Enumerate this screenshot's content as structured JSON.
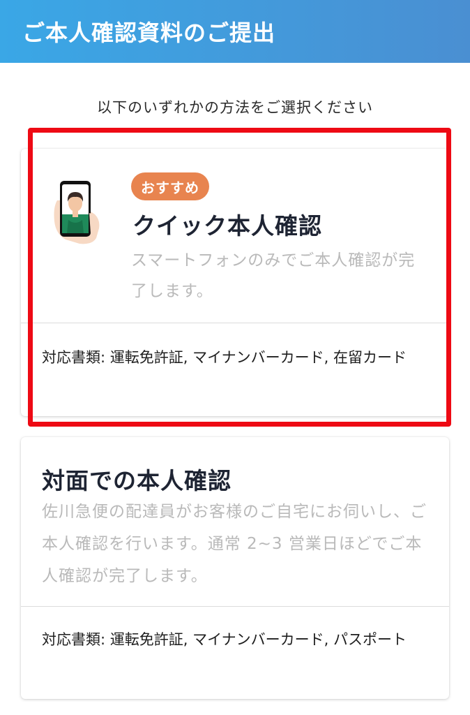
{
  "header": {
    "title": "ご本人確認資料のご提出",
    "background_start": "#3aa7e6",
    "background_end": "#4a8fd2"
  },
  "instruction": "以下のいずれかの方法をご選択ください",
  "options": [
    {
      "badge": "おすすめ",
      "title": "クイック本人確認",
      "description": "スマートフォンのみでご本人確認が完了します。",
      "documents": "対応書類: 運転免許証, マイナンバーカード, 在留カード",
      "icon": "smartphone-selfie-icon",
      "highlighted": true
    },
    {
      "title": "対面での本人確認",
      "description": "佐川急便の配達員がお客様のご自宅にお伺いし、ご本人確認を行います。通常 2~3 営業日ほどでご本人確認が完了します。",
      "documents": "対応書類: 運転免許証, マイナンバーカード, パスポート"
    }
  ],
  "colors": {
    "badge": "#e8844f",
    "highlight_border": "#ee0a14",
    "description_text": "#b9b9b9",
    "title_text": "#1e2433"
  }
}
